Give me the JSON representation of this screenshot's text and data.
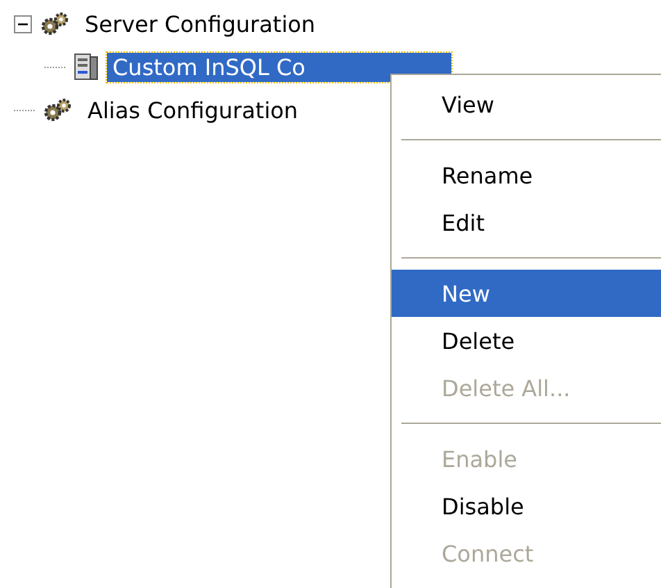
{
  "tree": [
    {
      "label": "Server Configuration",
      "kind": "gears",
      "expanded": true,
      "selected": false,
      "children": [
        {
          "label": "Custom InSQL Co",
          "kind": "server",
          "selected": true
        }
      ]
    },
    {
      "label": "Alias Configuration",
      "kind": "gears",
      "selected": false
    }
  ],
  "context_menu": {
    "items": [
      {
        "kind": "item",
        "label": "View",
        "disabled": false,
        "selected": false
      },
      {
        "kind": "separator"
      },
      {
        "kind": "item",
        "label": "Rename",
        "disabled": false,
        "selected": false
      },
      {
        "kind": "item",
        "label": "Edit",
        "disabled": false,
        "selected": false
      },
      {
        "kind": "separator"
      },
      {
        "kind": "item",
        "label": "New",
        "disabled": false,
        "selected": true
      },
      {
        "kind": "item",
        "label": "Delete",
        "disabled": false,
        "selected": false
      },
      {
        "kind": "item",
        "label": "Delete All...",
        "disabled": true,
        "selected": false
      },
      {
        "kind": "separator"
      },
      {
        "kind": "item",
        "label": "Enable",
        "disabled": true,
        "selected": false
      },
      {
        "kind": "item",
        "label": "Disable",
        "disabled": false,
        "selected": false
      },
      {
        "kind": "item",
        "label": "Connect",
        "disabled": true,
        "selected": false
      }
    ]
  }
}
